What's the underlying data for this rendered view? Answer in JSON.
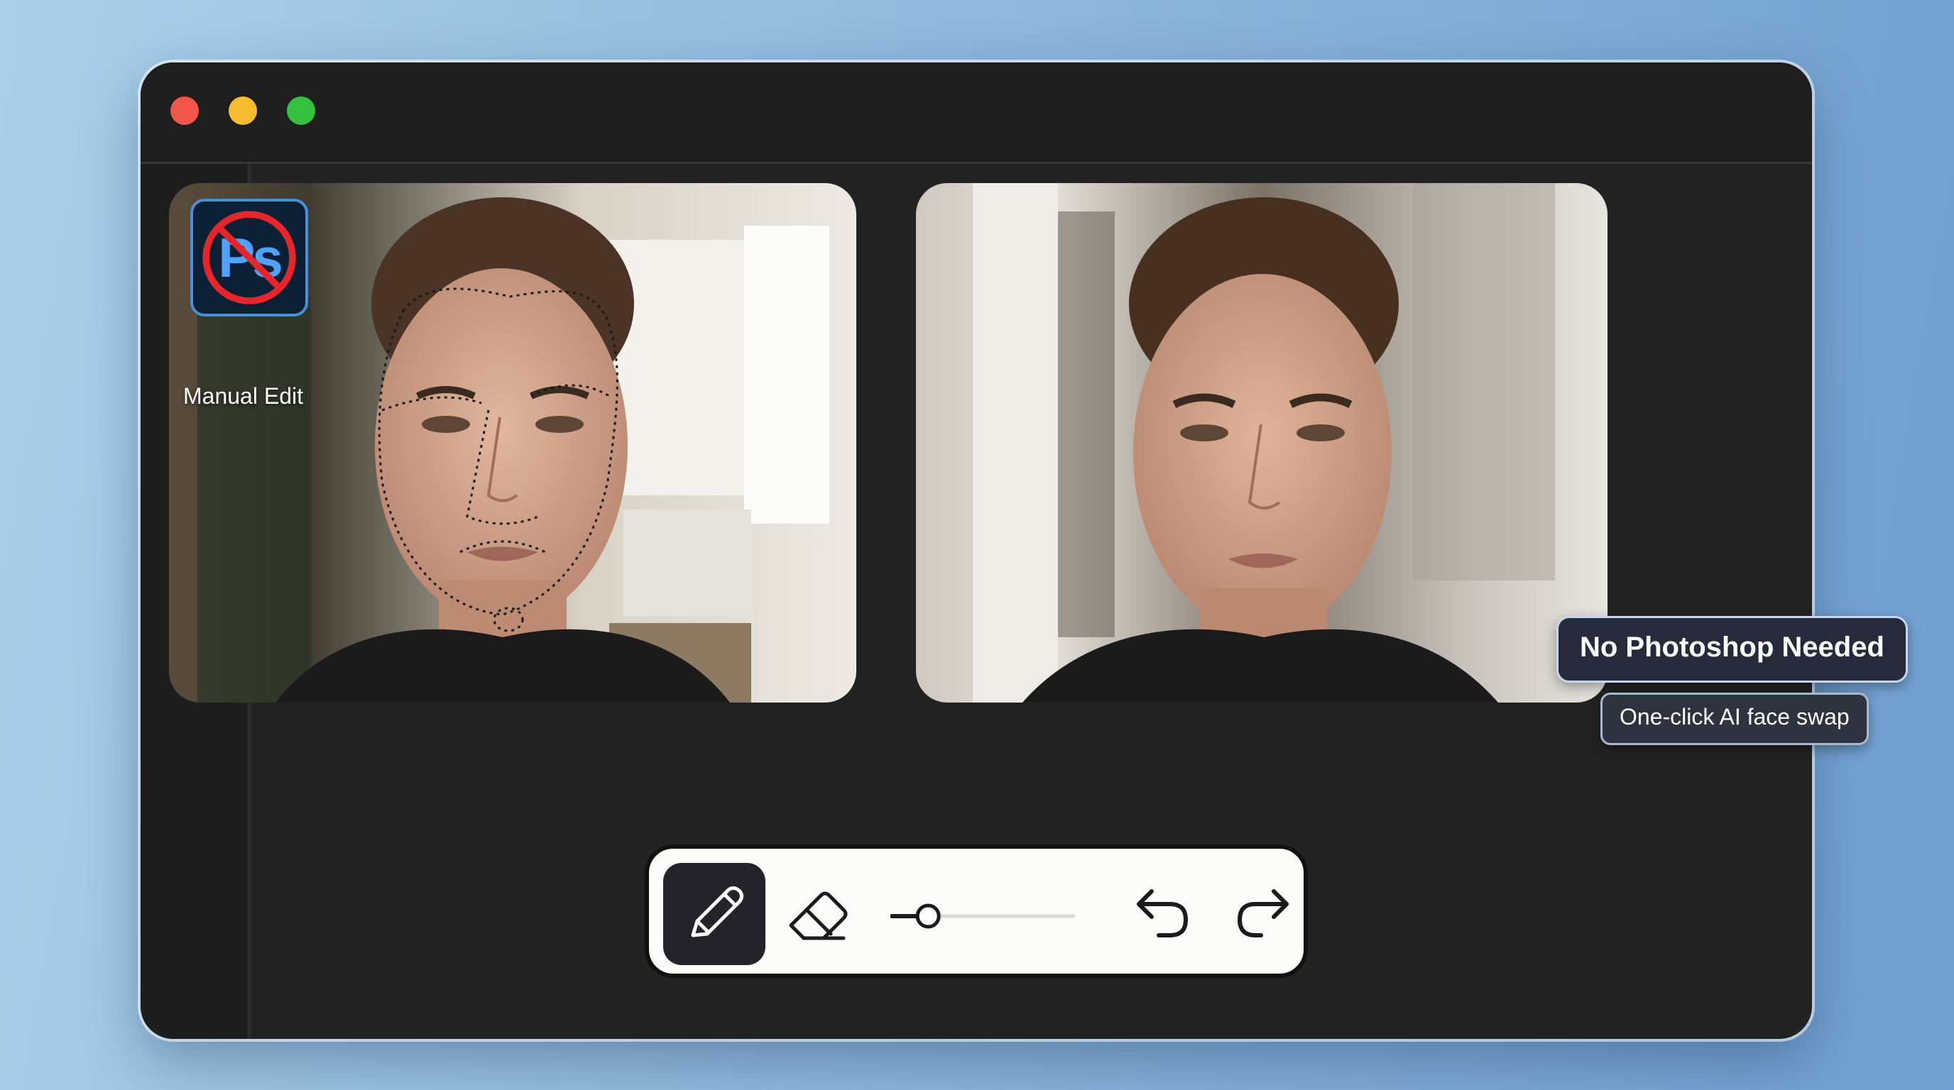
{
  "window": {
    "controls": [
      "close",
      "minimize",
      "maximize"
    ],
    "colors": {
      "close": "#f2564b",
      "minimize": "#f6bd2f",
      "maximize": "#34c23f"
    }
  },
  "sidebar": {
    "items": [
      {
        "icon": "waveform-logo-icon"
      },
      {
        "icon": "hash-grid-icon"
      },
      {
        "icon": "image-icon"
      },
      {
        "icon": "video-camera-icon"
      },
      {
        "icon": "user-icon"
      },
      {
        "icon": "audio-waveform-icon"
      }
    ],
    "accent": "#7d5cf5"
  },
  "before_panel": {
    "badge_text": "Ps",
    "label": "Manual Edit"
  },
  "after_panel": {
    "headline": "No Photoshop Needed",
    "subline": "One-click AI face swap"
  },
  "toolbar": {
    "tools": [
      "pencil",
      "eraser",
      "brush-size",
      "undo",
      "redo"
    ],
    "active_tool": "pencil",
    "brush_size_fraction": 0.2
  }
}
